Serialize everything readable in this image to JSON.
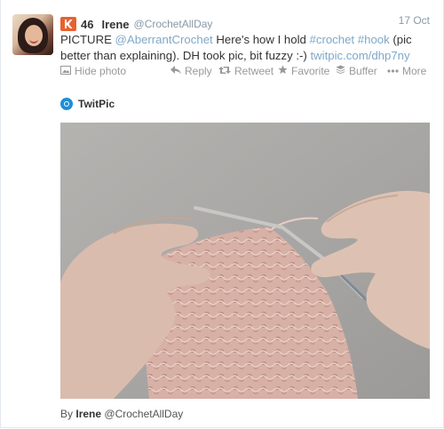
{
  "tweet": {
    "klout_score": "46",
    "name": "Irene",
    "handle": "@CrochetAllDay",
    "time": "17 Oct",
    "text_parts": {
      "t1": "PICTURE ",
      "l1": "@AberrantCrochet",
      "t2": " Here's how I hold ",
      "l2": "#crochet",
      "t3": " ",
      "l3": "#hook",
      "t4": " (pic better than explaining). DH took pic, bit fuzzy :-) ",
      "l4": "twitpic.com/dhp7ny"
    }
  },
  "actions": {
    "hide_photo": "Hide photo",
    "reply": "Reply",
    "retweet": "Retweet",
    "favorite": "Favorite",
    "buffer": "Buffer",
    "more": "More"
  },
  "media": {
    "provider": "TwitPic",
    "by_prefix": "By",
    "by_name": "Irene",
    "by_handle": "@CrochetAllDay"
  },
  "icons": {
    "klout": "klout-icon",
    "hide_photo": "photo-icon",
    "reply": "reply-icon",
    "retweet": "retweet-icon",
    "favorite": "star-icon",
    "buffer": "buffer-icon",
    "more": "more-dots-icon",
    "twitpic": "twitpic-logo-icon"
  },
  "colors": {
    "klout": "#e7612f",
    "link": "#7fa8c9",
    "muted": "#8899a6",
    "twitpic": "#1d8fd6"
  }
}
